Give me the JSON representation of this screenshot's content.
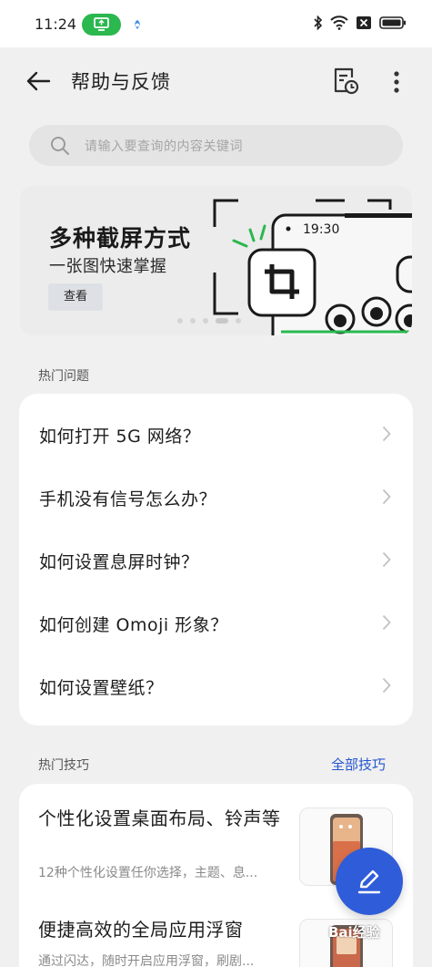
{
  "status_bar": {
    "time": "11:24"
  },
  "header": {
    "title": "帮助与反馈"
  },
  "search": {
    "placeholder": "请输入要查询的内容关键词"
  },
  "banner": {
    "title": "多种截屏方式",
    "subtitle": "一张图快速掌握",
    "button_label": "查看",
    "phone_time": "19:30"
  },
  "faq": {
    "section_label": "热门问题",
    "items": [
      {
        "label": "如何打开 5G 网络？"
      },
      {
        "label": "手机没有信号怎么办？"
      },
      {
        "label": "如何设置息屏时钟？"
      },
      {
        "label": "如何创建 Omoji 形象？"
      },
      {
        "label": "如何设置壁纸？"
      }
    ]
  },
  "tips": {
    "section_label": "热门技巧",
    "all_link": "全部技巧",
    "items": [
      {
        "title": "个性化设置桌面布局、铃声等",
        "desc": "12种个性化设置任你选择，主题、息..."
      },
      {
        "title": "便捷高效的全局应用浮窗",
        "desc": "通过闪达，随时开启应用浮窗，刷剧..."
      }
    ]
  },
  "watermark": "Bai经验",
  "colors": {
    "accent": "#2f5cd8",
    "link": "#2355d0",
    "cast_badge": "#2ab84f",
    "card": "#ffffff",
    "background": "#f0f0f0"
  }
}
